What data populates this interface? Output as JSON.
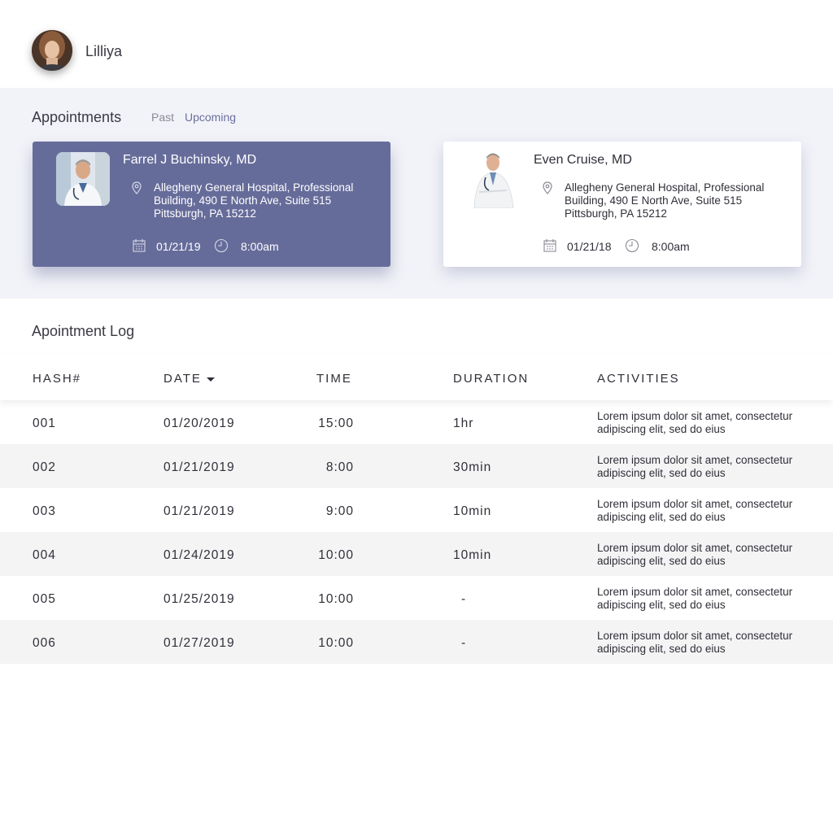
{
  "user": {
    "name": "Lilliya"
  },
  "appointments": {
    "title": "Appointments",
    "tabs": [
      {
        "label": "Past"
      },
      {
        "label": "Upcoming"
      }
    ],
    "cards": [
      {
        "doctor": "Farrel J Buchinsky, MD",
        "address": "Allegheny General Hospital, Professional Building, 490 E North Ave, Suite 515 Pittsburgh, PA 15212",
        "date": "01/21/19",
        "time": "8:00am"
      },
      {
        "doctor": "Even Cruise, MD",
        "address": "Allegheny General Hospital, Professional Building, 490 E North Ave, Suite 515 Pittsburgh, PA 15212",
        "date": "01/21/18",
        "time": "8:00am"
      }
    ]
  },
  "log": {
    "title": "Apointment Log",
    "columns": [
      "HASH#",
      "DATE",
      "TIME",
      "DURATION",
      "ACTIVITIES"
    ],
    "rows": [
      {
        "hash": "001",
        "date": "01/20/2019",
        "time": "15:00",
        "duration": "1hr",
        "activity": "Lorem ipsum dolor sit amet, consectetur adipiscing elit, sed do eius"
      },
      {
        "hash": "002",
        "date": "01/21/2019",
        "time": "8:00",
        "duration": "30min",
        "activity": "Lorem ipsum dolor sit amet, consectetur adipiscing elit, sed do eius"
      },
      {
        "hash": "003",
        "date": "01/21/2019",
        "time": "9:00",
        "duration": "10min",
        "activity": "Lorem ipsum dolor sit amet, consectetur adipiscing elit, sed do eius"
      },
      {
        "hash": "004",
        "date": "01/24/2019",
        "time": "10:00",
        "duration": "10min",
        "activity": "Lorem ipsum dolor sit amet, consectetur adipiscing elit, sed do eius"
      },
      {
        "hash": "005",
        "date": "01/25/2019",
        "time": "10:00",
        "duration": "-",
        "activity": "Lorem ipsum dolor sit amet, consectetur adipiscing elit, sed do eius"
      },
      {
        "hash": "006",
        "date": "01/27/2019",
        "time": "10:00",
        "duration": "-",
        "activity": "Lorem ipsum dolor sit amet, consectetur adipiscing elit, sed do eius"
      }
    ]
  },
  "icons": [
    "location-pin-icon",
    "calendar-icon",
    "clock-icon",
    "sort-caret-icon"
  ],
  "colors": {
    "accent": "#666c9a",
    "tab_active": "#6b6f9e",
    "band_bg": "#f2f3f8",
    "row_alt": "#f4f4f5"
  }
}
